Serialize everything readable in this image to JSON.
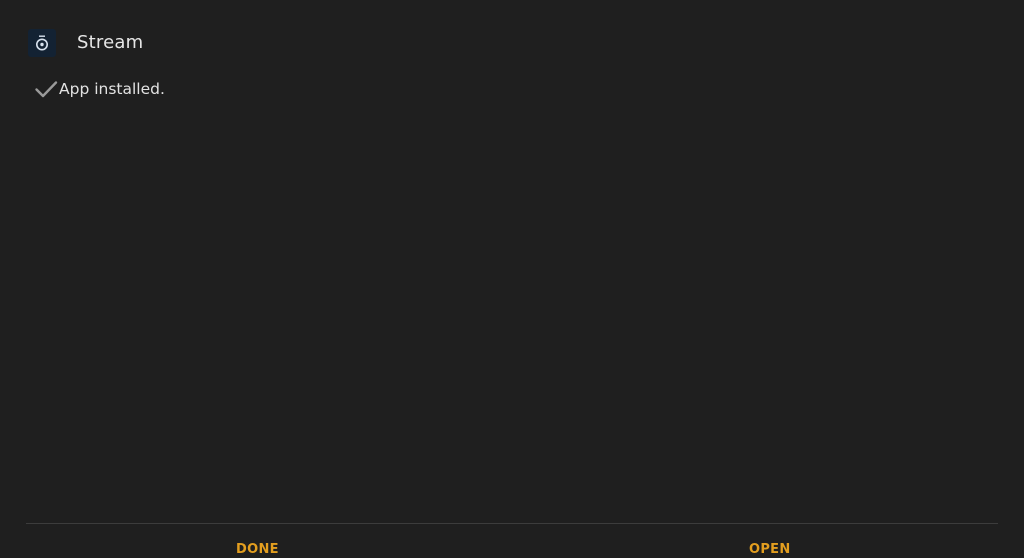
{
  "app": {
    "name": "Stream",
    "icon": "stream-app-icon"
  },
  "status": {
    "icon": "check-icon",
    "text": "App installed."
  },
  "actions": {
    "done_label": "DONE",
    "open_label": "OPEN"
  },
  "colors": {
    "background": "#1f1f1f",
    "accent": "#e39e1f",
    "divider": "#3c3c3c",
    "text": "#e6e6e6"
  }
}
